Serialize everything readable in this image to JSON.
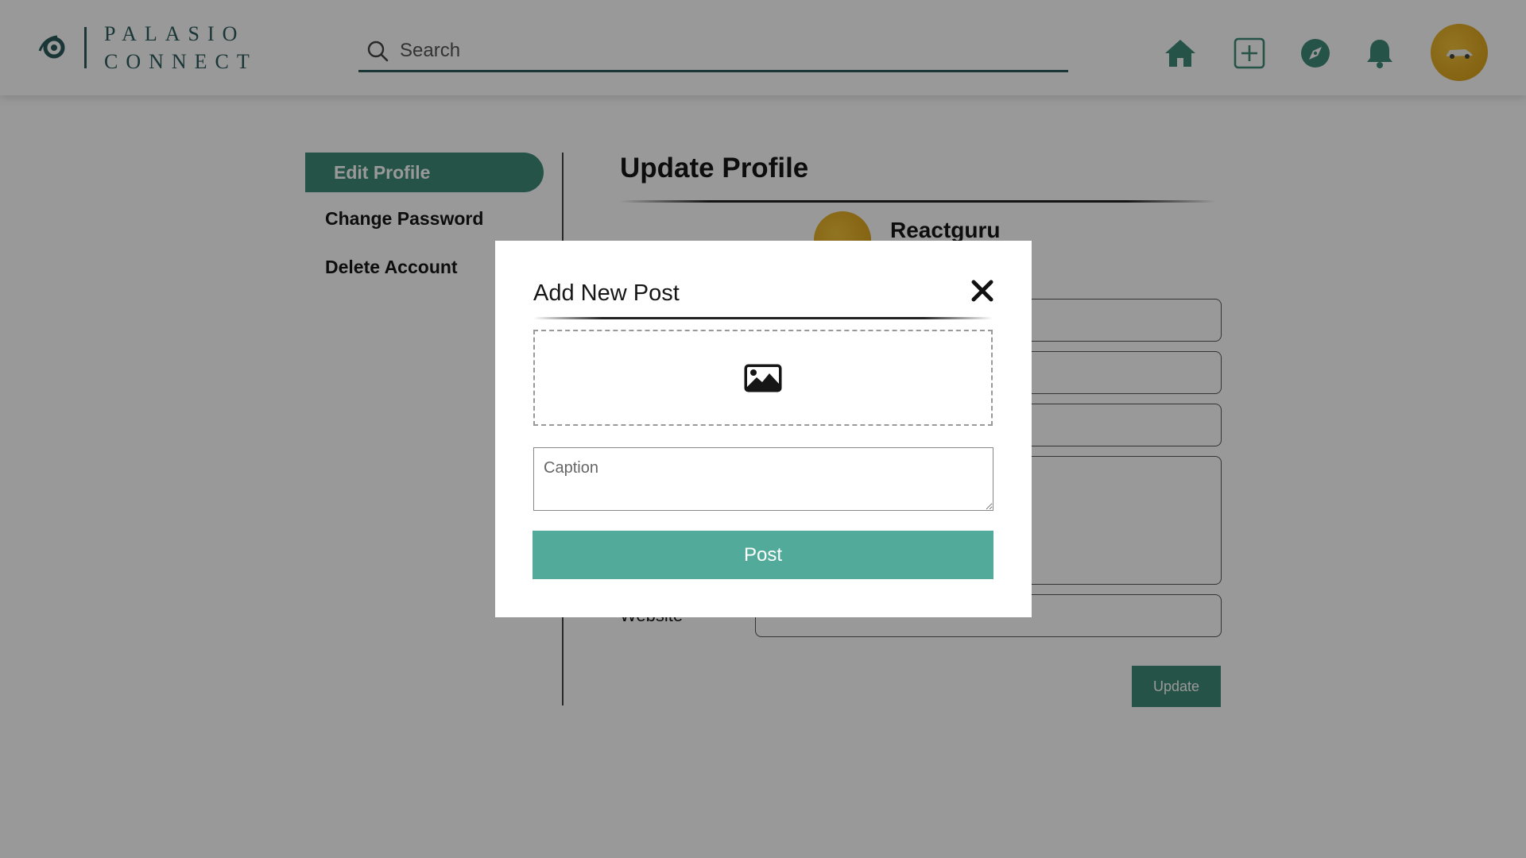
{
  "header": {
    "brand_line1": "PALASIO",
    "brand_line2": "CONNECT",
    "search_placeholder": "Search",
    "icons": [
      "home-icon",
      "add-post-icon",
      "explore-icon",
      "bell-icon",
      "profile-avatar"
    ]
  },
  "sidebar": {
    "items": [
      {
        "label": "Edit Profile",
        "active": true
      },
      {
        "label": "Change Password",
        "active": false
      },
      {
        "label": "Delete Account",
        "active": false
      }
    ]
  },
  "main": {
    "title": "Update Profile",
    "username": "Reactguru",
    "website_label": "Website",
    "update_label": "Update"
  },
  "modal": {
    "title": "Add New Post",
    "caption_placeholder": "Caption",
    "post_label": "Post"
  },
  "colors": {
    "brand": "#2d5b5b",
    "accent": "#3f8a78",
    "post_button": "#52ab9a",
    "overlay": "rgba(0,0,0,0.4)"
  }
}
